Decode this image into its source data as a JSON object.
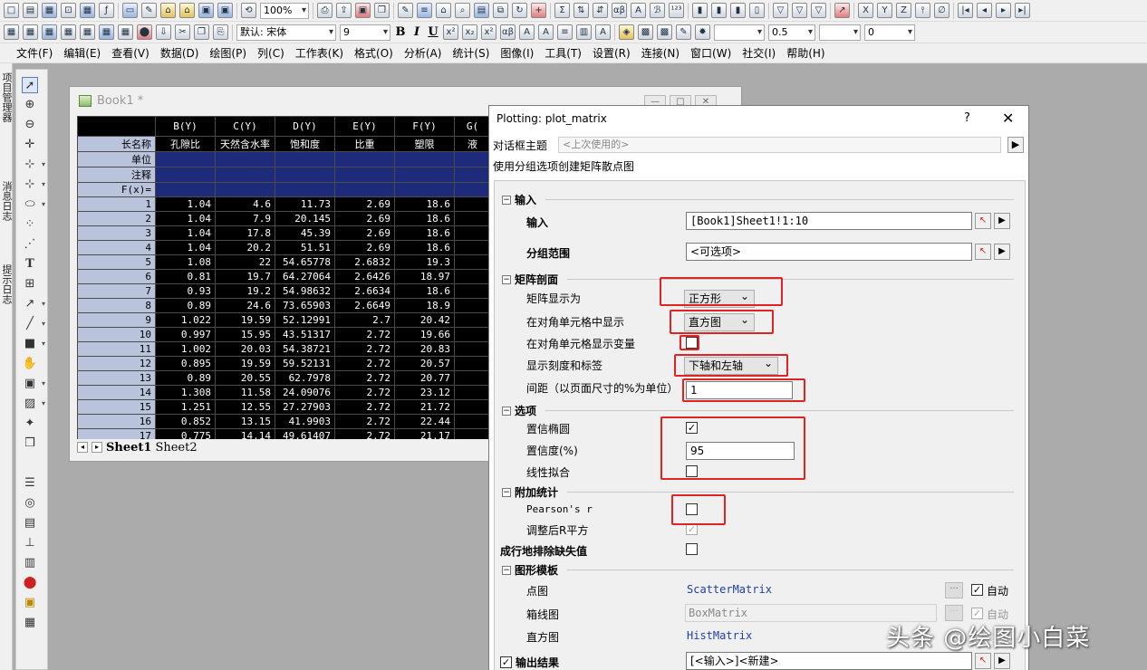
{
  "toolbar1": {
    "zoom": "100%"
  },
  "toolbar2": {
    "font": "默认: 宋体",
    "font_size": "9",
    "line_width": "0.5",
    "angle": "0",
    "format_buttons": [
      "B",
      "I",
      "U"
    ]
  },
  "menu": [
    "文件(F)",
    "编辑(E)",
    "查看(V)",
    "数据(D)",
    "绘图(P)",
    "列(C)",
    "工作表(K)",
    "格式(O)",
    "分析(A)",
    "统计(S)",
    "图像(I)",
    "工具(T)",
    "设置(R)",
    "连接(N)",
    "窗口(W)",
    "社交(I)",
    "帮助(H)"
  ],
  "left_tabs": [
    "项目管理器",
    "消息日志",
    "提示日志"
  ],
  "book": {
    "title": "Book1 *",
    "columns": [
      "B(Y)",
      "C(Y)",
      "D(Y)",
      "E(Y)",
      "F(Y)",
      "G("
    ],
    "row_labels": [
      "长名称",
      "单位",
      "注释",
      "F(x)="
    ],
    "long_names": [
      "孔隙比",
      "天然含水率",
      "饱和度",
      "比重",
      "塑限",
      "液"
    ],
    "rows": [
      [
        "1",
        "1.04",
        "4.6",
        "11.73",
        "2.69",
        "18.6"
      ],
      [
        "2",
        "1.04",
        "7.9",
        "20.145",
        "2.69",
        "18.6"
      ],
      [
        "3",
        "1.04",
        "17.8",
        "45.39",
        "2.69",
        "18.6"
      ],
      [
        "4",
        "1.04",
        "20.2",
        "51.51",
        "2.69",
        "18.6"
      ],
      [
        "5",
        "1.08",
        "22",
        "54.65778",
        "2.6832",
        "19.3"
      ],
      [
        "6",
        "0.81",
        "19.7",
        "64.27064",
        "2.6426",
        "18.97"
      ],
      [
        "7",
        "0.93",
        "19.2",
        "54.98632",
        "2.6634",
        "18.6"
      ],
      [
        "8",
        "0.89",
        "24.6",
        "73.65903",
        "2.6649",
        "18.9"
      ],
      [
        "9",
        "1.022",
        "19.59",
        "52.12991",
        "2.7",
        "20.42"
      ],
      [
        "10",
        "0.997",
        "15.95",
        "43.51317",
        "2.72",
        "19.66"
      ],
      [
        "11",
        "1.002",
        "20.03",
        "54.38721",
        "2.72",
        "20.83"
      ],
      [
        "12",
        "0.895",
        "19.59",
        "59.52131",
        "2.72",
        "20.57"
      ],
      [
        "13",
        "0.89",
        "20.55",
        "62.7978",
        "2.72",
        "20.77"
      ],
      [
        "14",
        "1.308",
        "11.58",
        "24.09076",
        "2.72",
        "23.12"
      ],
      [
        "15",
        "1.251",
        "12.55",
        "27.27903",
        "2.72",
        "21.72"
      ],
      [
        "16",
        "0.852",
        "13.15",
        "41.9903",
        "2.72",
        "22.44"
      ],
      [
        "17",
        "0.775",
        "14.14",
        "49.61407",
        "2.72",
        "21.17"
      ]
    ],
    "sheets": [
      "Sheet1",
      "Sheet2"
    ]
  },
  "dialog": {
    "title": "Plotting: plot_matrix",
    "help": "?",
    "close": "✕",
    "theme_label": "对话框主题",
    "theme_value": "<上次使用的>",
    "description": "使用分组选项创建矩阵散点图",
    "sections": {
      "input": "输入",
      "matrix": "矩阵剖面",
      "options": "选项",
      "stats": "附加统计",
      "templates": "图形模板",
      "output": "输出结果"
    },
    "input_label": "输入",
    "input_value": "[Book1]Sheet1!1:10",
    "group_label": "分组范围",
    "group_value": "<可选项>",
    "matrix_display_label": "矩阵显示为",
    "matrix_display_value": "正方形",
    "diag_label": "在对角单元格中显示",
    "diag_value": "直方图",
    "diag_var_label": "在对角单元格显示变量",
    "ticks_label": "显示刻度和标签",
    "ticks_value": "下轴和左轴",
    "spacing_label": "间距（以页面尺寸的%为单位）",
    "spacing_value": "1",
    "conf_ellipse_label": "置信椭圆",
    "conf_level_label": "置信度(%)",
    "conf_level_value": "95",
    "linear_fit_label": "线性拟合",
    "pearson_label": "Pearson's r",
    "adj_r_label": "调整后R平方",
    "exclude_label": "成行地排除缺失值",
    "scatter_label": "点图",
    "scatter_value": "ScatterMatrix",
    "box_label": "箱线图",
    "box_value": "BoxMatrix",
    "hist_label": "直方图",
    "hist_value": "HistMatrix",
    "auto_label": "自动",
    "output_value": "[<输入>]<新建>"
  },
  "watermark": "头条 @绘图小白菜"
}
